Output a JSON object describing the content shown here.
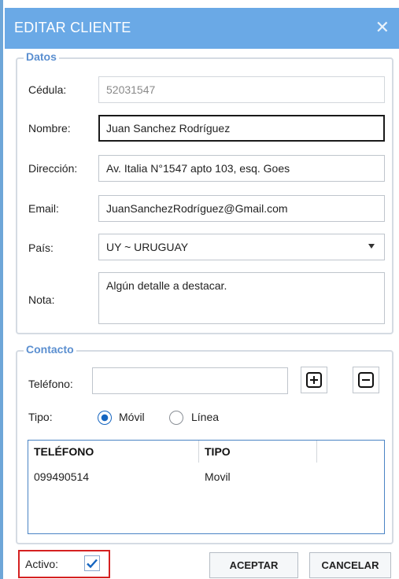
{
  "window": {
    "title": "EDITAR CLIENTE",
    "close_glyph": "✕"
  },
  "datos": {
    "legend": "Datos",
    "cedula": {
      "label": "Cédula:",
      "value": "52031547"
    },
    "nombre": {
      "label": "Nombre:",
      "value": "Juan Sanchez Rodríguez"
    },
    "direccion": {
      "label": "Dirección:",
      "value": "Av. Italia N°1547 apto 103, esq. Goes"
    },
    "email": {
      "label": "Email:",
      "value": "JuanSanchezRodríguez@Gmail.com"
    },
    "pais": {
      "label": "País:",
      "selected": "UY ~ URUGUAY"
    },
    "nota": {
      "label": "Nota:",
      "value": "Algún detalle a destacar."
    }
  },
  "contacto": {
    "legend": "Contacto",
    "telefono": {
      "label": "Teléfono:",
      "value": ""
    },
    "add_icon": "plus-square-icon",
    "remove_icon": "minus-square-icon",
    "tipo": {
      "label": "Tipo:",
      "options": [
        {
          "label": "Móvil",
          "selected": true
        },
        {
          "label": "Línea",
          "selected": false
        }
      ]
    },
    "table": {
      "columns": [
        "TELÉFONO",
        "TIPO"
      ],
      "rows": [
        {
          "telefono": "099490514",
          "tipo": "Movil"
        }
      ]
    }
  },
  "footer": {
    "activo": {
      "label": "Activo:",
      "checked": true
    },
    "aceptar": "ACEPTAR",
    "cancelar": "CANCELAR"
  },
  "colors": {
    "title_bar": "#6aa9e6",
    "legend": "#5b8fd0",
    "accent": "#1565c0",
    "highlight": "#d52121"
  }
}
